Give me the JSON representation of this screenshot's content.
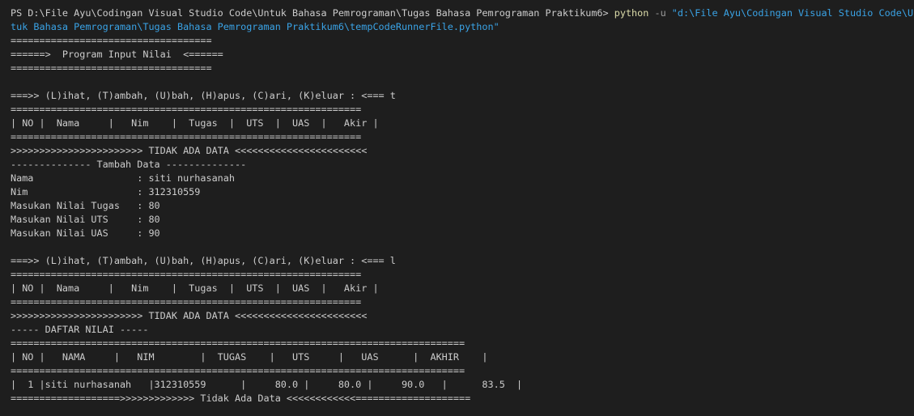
{
  "terminal": {
    "prompt": "PS D:\\File Ayu\\Codingan Visual Studio Code\\Untuk Bahasa Pemrograman\\Tugas Bahasa Pemrograman Praktikum6> ",
    "command": "python",
    "flag": " -u ",
    "arg_line1": "\"d:\\File Ayu\\Codingan Visual Studio Code\\Un",
    "arg_line2": "tuk Bahasa Pemrograman\\Tugas Bahasa Pemrograman Praktikum6\\tempCodeRunnerFile.python\"",
    "lines": [
      "===================================",
      "======>  Program Input Nilai  <======",
      "===================================",
      "",
      "===>> (L)ihat, (T)ambah, (U)bah, (H)apus, (C)ari, (K)eluar : <=== t",
      "=============================================================",
      "| NO |  Nama     |   Nim    |  Tugas  |  UTS  |  UAS  |   Akir |",
      "=============================================================",
      ">>>>>>>>>>>>>>>>>>>>>>> TIDAK ADA DATA <<<<<<<<<<<<<<<<<<<<<<<",
      "-------------- Tambah Data --------------",
      "Nama                  : siti nurhasanah",
      "Nim                   : 312310559",
      "Masukan Nilai Tugas   : 80",
      "Masukan Nilai UTS     : 80",
      "Masukan Nilai UAS     : 90",
      "",
      "===>> (L)ihat, (T)ambah, (U)bah, (H)apus, (C)ari, (K)eluar : <=== l",
      "=============================================================",
      "| NO |  Nama     |   Nim    |  Tugas  |  UTS  |  UAS  |   Akir |",
      "=============================================================",
      ">>>>>>>>>>>>>>>>>>>>>>> TIDAK ADA DATA <<<<<<<<<<<<<<<<<<<<<<<",
      "----- DAFTAR NILAI -----",
      "===============================================================================",
      "| NO |   NAMA     |   NIM        |  TUGAS    |   UTS     |   UAS      |  AKHIR    |",
      "===============================================================================",
      "|  1 |siti nurhasanah   |312310559      |     80.0 |     80.0 |     90.0   |      83.5  |",
      "===================>>>>>>>>>>>>> Tidak Ada Data <<<<<<<<<<<<===================="
    ]
  }
}
